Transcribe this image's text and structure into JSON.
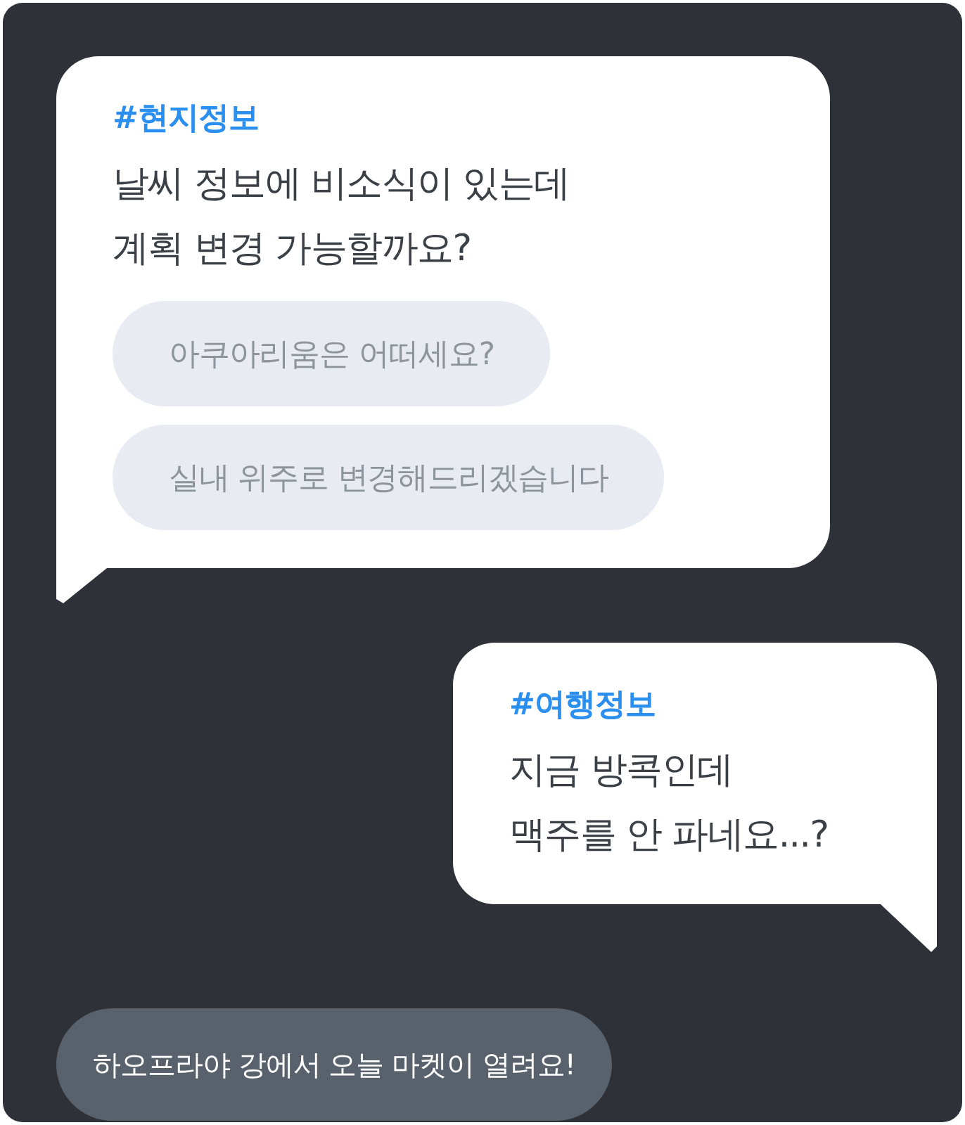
{
  "messages": [
    {
      "kind": "incoming",
      "tag": "#현지정보",
      "lines": [
        "날씨 정보에 비소식이 있는데",
        "계획 변경 가능할까요?"
      ],
      "suggestions": [
        "아쿠아리움은 어떠세요?",
        "실내 위주로 변경해드리겠습니다"
      ]
    },
    {
      "kind": "outgoing",
      "tag": "#여행정보",
      "lines": [
        "지금 방콕인데",
        "맥주를 안 파네요...?"
      ]
    },
    {
      "kind": "notice",
      "text": "하오프라야 강에서 오늘 마켓이 열려요!"
    }
  ]
}
